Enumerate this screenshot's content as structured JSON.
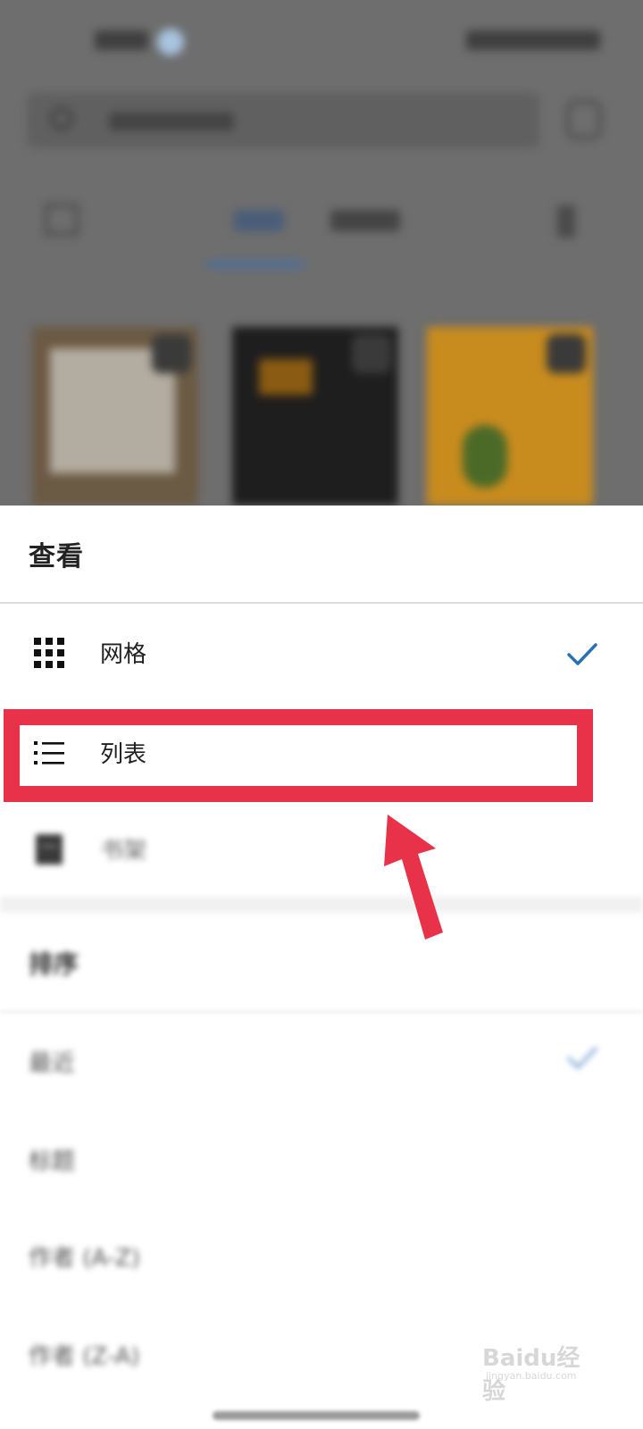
{
  "sheet": {
    "title": "查看",
    "view_options": [
      {
        "label": "网格",
        "icon": "grid-icon",
        "selected": true
      },
      {
        "label": "列表",
        "icon": "list-icon",
        "selected": false
      },
      {
        "label": "书架",
        "icon": "bookshelf-icon",
        "selected": false
      }
    ],
    "sort_header": "排序",
    "sort_options": [
      {
        "label": "最近",
        "selected": true
      },
      {
        "label": "标题",
        "selected": false
      },
      {
        "label": "作者 (A-Z)",
        "selected": false
      },
      {
        "label": "作者 (Z-A)",
        "selected": false
      }
    ]
  },
  "background": {
    "tabs": [
      "全部",
      "已下载"
    ]
  },
  "colors": {
    "accent": "#2d6fb3",
    "highlight": "#e8324a",
    "scrim": "#6e6e6e"
  },
  "watermark": {
    "brand": "Baidu经验",
    "site": "jingyan.baidu.com"
  }
}
